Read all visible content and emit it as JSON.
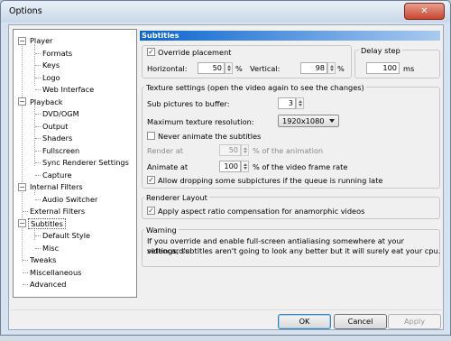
{
  "window": {
    "title": "Options",
    "close_glyph": "✕"
  },
  "tree": {
    "items": [
      {
        "label": "Player",
        "expander": "−"
      },
      {
        "label": "Formats"
      },
      {
        "label": "Keys"
      },
      {
        "label": "Logo"
      },
      {
        "label": "Web Interface"
      },
      {
        "label": "Playback",
        "expander": "−"
      },
      {
        "label": "DVD/OGM"
      },
      {
        "label": "Output"
      },
      {
        "label": "Shaders"
      },
      {
        "label": "Fullscreen"
      },
      {
        "label": "Sync Renderer Settings"
      },
      {
        "label": "Capture"
      },
      {
        "label": "Internal Filters",
        "expander": "−"
      },
      {
        "label": "Audio Switcher"
      },
      {
        "label": "External Filters"
      },
      {
        "label": "Subtitles",
        "expander": "−",
        "selected": true
      },
      {
        "label": "Default Style"
      },
      {
        "label": "Misc"
      },
      {
        "label": "Tweaks"
      },
      {
        "label": "Miscellaneous"
      },
      {
        "label": "Advanced"
      }
    ]
  },
  "panel": {
    "title": "Subtitles",
    "override_placement": {
      "label": "Override placement",
      "checked": true
    },
    "horizontal": {
      "label": "Horizontal:",
      "value": "50",
      "unit": "%"
    },
    "vertical": {
      "label": "Vertical:",
      "value": "98",
      "unit": "%"
    },
    "delay": {
      "group": "Delay step",
      "value": "100",
      "unit": "ms"
    },
    "texture": {
      "group": "Texture settings (open the video again to see the changes)",
      "buffer_label": "Sub pictures to buffer:",
      "buffer_value": "3",
      "max_res_label": "Maximum texture resolution:",
      "max_res_value": "1920x1080",
      "never_animate": {
        "label": "Never animate the subtitles",
        "checked": false
      },
      "render_at_label": "Render at",
      "render_at_value": "50",
      "render_at_suffix": "% of the animation",
      "animate_at_label": "Animate at",
      "animate_at_value": "100",
      "animate_at_suffix": "% of the video frame rate",
      "allow_dropping": {
        "label": "Allow dropping some subpictures if the queue is running late",
        "checked": true
      }
    },
    "renderer": {
      "group": "Renderer Layout",
      "aspect": {
        "label": "Apply aspect ratio compensation for anamorphic videos",
        "checked": true
      }
    },
    "warning": {
      "group": "Warning",
      "lines": [
        "If you override and enable full-screen antialiasing somewhere at your videocard's",
        "settings, subtitles aren't going to look any better but it will surely eat your cpu."
      ]
    }
  },
  "buttons": {
    "ok": "OK",
    "cancel": "Cancel",
    "apply": "Apply"
  }
}
